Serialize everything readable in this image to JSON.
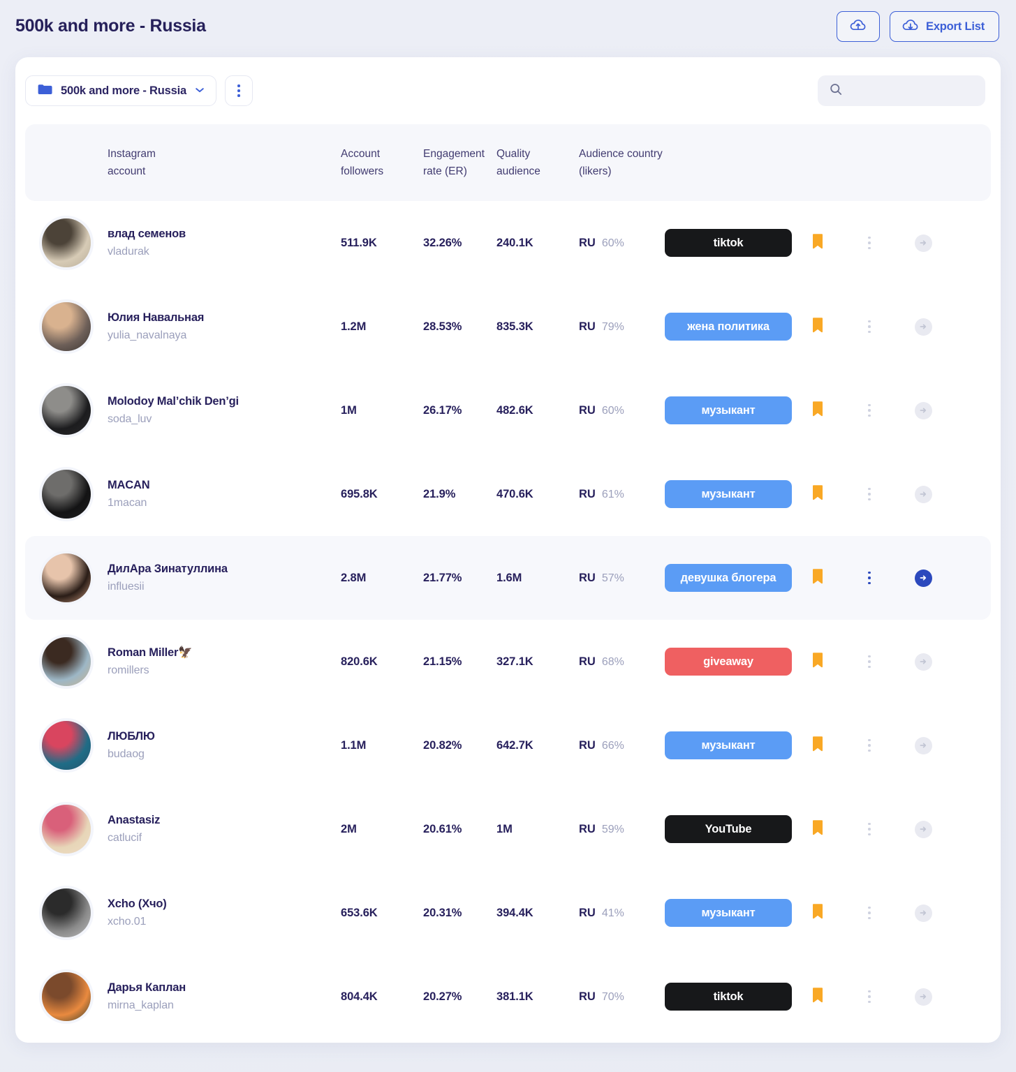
{
  "header": {
    "title": "500k and more - Russia",
    "import_button": {
      "label": "",
      "icon": "cloud-upload-icon"
    },
    "export_button": {
      "label": "Export List",
      "icon": "cloud-download-icon"
    }
  },
  "toolbar": {
    "folder_label": "500k and more - Russia",
    "folder_icon": "folder-icon",
    "chevron_icon": "chevron-down-icon",
    "kebab_icon": "more-vertical-icon",
    "search": {
      "value": "",
      "placeholder": "",
      "icon": "search-icon"
    }
  },
  "table": {
    "columns": [
      {
        "line1": "",
        "line2": ""
      },
      {
        "line1": "Instagram",
        "line2": "account"
      },
      {
        "line1": "Account",
        "line2": "followers"
      },
      {
        "line1": "Engagement",
        "line2": "rate (ER)"
      },
      {
        "line1": "Quality",
        "line2": "audience"
      },
      {
        "line1": "Audience country",
        "line2": "(likers)"
      }
    ],
    "row_icons": {
      "bookmark": "bookmark-icon",
      "kebab": "more-vertical-icon",
      "go": "arrow-right-circle-icon"
    },
    "rows": [
      {
        "name": "влад семенов",
        "handle": "vladurak",
        "followers": "511.9K",
        "er": "32.26%",
        "quality_audience": "240.1K",
        "country_code": "RU",
        "country_pct": "60%",
        "tag": "tiktok",
        "tag_color": "#17181a",
        "bookmarked": true,
        "active": false,
        "avatar_colors": [
          "#d7cbb6",
          "#4c4338",
          "#b7ac96"
        ]
      },
      {
        "name": "Юлия Навальная",
        "handle": "yulia_navalnaya",
        "followers": "1.2M",
        "er": "28.53%",
        "quality_audience": "835.3K",
        "country_code": "RU",
        "country_pct": "79%",
        "tag": "жена политика",
        "tag_color": "#5b9cf5",
        "bookmarked": true,
        "active": false,
        "avatar_colors": [
          "#6d5f58",
          "#d9b28f",
          "#3a3430"
        ]
      },
      {
        "name": "Molodoy Mal’chik Den’gi",
        "handle": "soda_luv",
        "followers": "1M",
        "er": "26.17%",
        "quality_audience": "482.6K",
        "country_code": "RU",
        "country_pct": "60%",
        "tag": "музыкант",
        "tag_color": "#5b9cf5",
        "bookmarked": true,
        "active": false,
        "avatar_colors": [
          "#1c1c1e",
          "#8e8d8a",
          "#2a2a2c"
        ]
      },
      {
        "name": "MACAN",
        "handle": "1macan",
        "followers": "695.8K",
        "er": "21.9%",
        "quality_audience": "470.6K",
        "country_code": "RU",
        "country_pct": "61%",
        "tag": "музыкант",
        "tag_color": "#5b9cf5",
        "bookmarked": true,
        "active": false,
        "avatar_colors": [
          "#131314",
          "#6e6d6b",
          "#202021"
        ]
      },
      {
        "name": "ДилАра Зинатуллина",
        "handle": "influesii",
        "followers": "2.8M",
        "er": "21.77%",
        "quality_audience": "1.6M",
        "country_code": "RU",
        "country_pct": "57%",
        "tag": "девушка блогера",
        "tag_color": "#5b9cf5",
        "bookmarked": true,
        "active": true,
        "avatar_colors": [
          "#2a1d17",
          "#e7c4ab",
          "#c9997c"
        ]
      },
      {
        "name": "Roman Miller🦅",
        "handle": "romillers",
        "followers": "820.6K",
        "er": "21.15%",
        "quality_audience": "327.1K",
        "country_code": "RU",
        "country_pct": "68%",
        "tag": "giveaway",
        "tag_color": "#ef6061",
        "bookmarked": true,
        "active": false,
        "avatar_colors": [
          "#9db7c6",
          "#3b2a21",
          "#c9b28e"
        ]
      },
      {
        "name": "ЛЮБЛЮ",
        "handle": "budaog",
        "followers": "1.1M",
        "er": "20.82%",
        "quality_audience": "642.7K",
        "country_code": "RU",
        "country_pct": "66%",
        "tag": "музыкант",
        "tag_color": "#5b9cf5",
        "bookmarked": true,
        "active": false,
        "avatar_colors": [
          "#1f6c86",
          "#d9455f",
          "#27526b"
        ]
      },
      {
        "name": "Anastasiz",
        "handle": "catlucif",
        "followers": "2M",
        "er": "20.61%",
        "quality_audience": "1M",
        "country_code": "RU",
        "country_pct": "59%",
        "tag": "YouTube",
        "tag_color": "#17181a",
        "bookmarked": true,
        "active": false,
        "avatar_colors": [
          "#e7d6b8",
          "#d9607a",
          "#f0dcc4"
        ]
      },
      {
        "name": "Xcho (Хчо)",
        "handle": "xcho.01",
        "followers": "653.6K",
        "er": "20.31%",
        "quality_audience": "394.4K",
        "country_code": "RU",
        "country_pct": "41%",
        "tag": "музыкант",
        "tag_color": "#5b9cf5",
        "bookmarked": true,
        "active": false,
        "avatar_colors": [
          "#8a8a8a",
          "#2b2b2b",
          "#bdbdbd"
        ]
      },
      {
        "name": "Дарья Каплан",
        "handle": "mirna_kaplan",
        "followers": "804.4K",
        "er": "20.27%",
        "quality_audience": "381.1K",
        "country_code": "RU",
        "country_pct": "70%",
        "tag": "tiktok",
        "tag_color": "#17181a",
        "bookmarked": true,
        "active": false,
        "avatar_colors": [
          "#e98a3f",
          "#7b4a2c",
          "#2e3b2a"
        ]
      }
    ]
  },
  "colors": {
    "accent": "#3c5fd7",
    "accent_dark": "#2c49bd",
    "text": "#27205c",
    "muted": "#9b9fbb",
    "bookmark": "#f9a825",
    "page_bg": "#edeff6",
    "header_bg": "#f6f7fb",
    "row_active_bg": "#f7f8fc"
  }
}
